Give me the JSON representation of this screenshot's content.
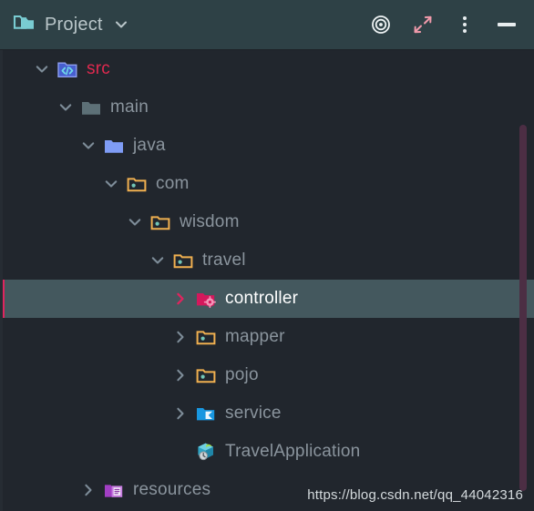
{
  "window": {
    "title": "Project",
    "title_icon": "project-folder-icon",
    "title_chevron": "chevron-down-icon"
  },
  "toolbar": {
    "items": [
      {
        "name": "locate-target-icon",
        "label": "Select Opened File"
      },
      {
        "name": "collapse-all-icon",
        "label": "Collapse All"
      },
      {
        "name": "options-kebab-icon",
        "label": "Options"
      },
      {
        "name": "minimize-icon",
        "label": "Hide"
      }
    ]
  },
  "tree": {
    "rows": [
      {
        "label": "src",
        "indent": 36,
        "arrow": "chevron-down-icon",
        "icon": "source-root-folder-icon",
        "selected": false,
        "style": "src"
      },
      {
        "label": "main",
        "indent": 62,
        "arrow": "chevron-down-icon",
        "icon": "gray-folder-icon",
        "selected": false,
        "style": ""
      },
      {
        "label": "java",
        "indent": 87,
        "arrow": "chevron-down-icon",
        "icon": "blue-folder-icon",
        "selected": false,
        "style": ""
      },
      {
        "label": "com",
        "indent": 112,
        "arrow": "chevron-down-icon",
        "icon": "package-folder-icon",
        "selected": false,
        "style": ""
      },
      {
        "label": "wisdom",
        "indent": 138,
        "arrow": "chevron-down-icon",
        "icon": "package-folder-icon",
        "selected": false,
        "style": ""
      },
      {
        "label": "travel",
        "indent": 163,
        "arrow": "chevron-down-icon",
        "icon": "package-folder-icon",
        "selected": false,
        "style": ""
      },
      {
        "label": "controller",
        "indent": 188,
        "arrow": "chevron-right-icon",
        "icon": "controller-package-icon",
        "selected": true,
        "style": ""
      },
      {
        "label": "mapper",
        "indent": 188,
        "arrow": "chevron-right-icon",
        "icon": "package-folder-icon",
        "selected": false,
        "style": ""
      },
      {
        "label": "pojo",
        "indent": 188,
        "arrow": "chevron-right-icon",
        "icon": "package-folder-icon",
        "selected": false,
        "style": ""
      },
      {
        "label": "service",
        "indent": 188,
        "arrow": "chevron-right-icon",
        "icon": "service-folder-icon",
        "selected": false,
        "style": ""
      },
      {
        "label": "TravelApplication",
        "indent": 188,
        "arrow": "none",
        "icon": "spring-boot-class-icon",
        "selected": false,
        "style": ""
      },
      {
        "label": "resources",
        "indent": 87,
        "arrow": "chevron-right-icon",
        "icon": "resource-root-icon",
        "selected": false,
        "style": ""
      }
    ]
  },
  "watermark": {
    "text": "https://blog.csdn.net/qq_44042316"
  },
  "colors": {
    "header_bg": "#2e4146",
    "tree_bg": "#21262d",
    "selection_bg": "#44585e",
    "selection_accent": "#e0245e",
    "text": "#8a949d",
    "src_text": "#e0294f",
    "selected_text": "#ffffff",
    "scrollbar": "#4c2e44"
  }
}
